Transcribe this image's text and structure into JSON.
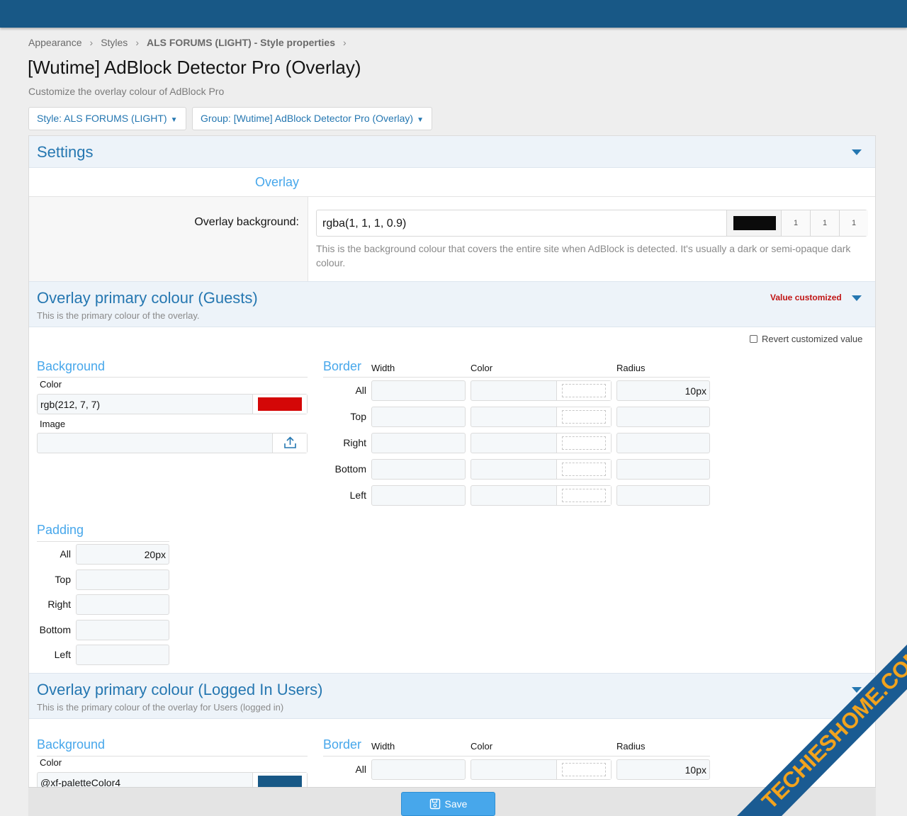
{
  "breadcrumb": {
    "items": [
      "Appearance",
      "Styles",
      "ALS FORUMS (LIGHT) - Style properties"
    ]
  },
  "page": {
    "title": "[Wutime] AdBlock Detector Pro (Overlay)",
    "description": "Customize the overlay colour of AdBlock Pro"
  },
  "filters": {
    "style": "Style: ALS FORUMS (LIGHT)",
    "group": "Group: [Wutime] AdBlock Detector Pro (Overlay)"
  },
  "settings": {
    "title": "Settings",
    "section": "Overlay",
    "overlay_bg": {
      "label": "Overlay background:",
      "value": "rgba(1, 1, 1, 0.9)",
      "swatch": "#0b0b0b",
      "channels": [
        "1",
        "1",
        "1"
      ],
      "explain": "This is the background colour that covers the entire site when AdBlock is detected. It's usually a dark or semi-opaque dark colour."
    }
  },
  "guests": {
    "title": "Overlay primary colour (Guests)",
    "description": "This is the primary colour of the overlay.",
    "status": "Value customized",
    "revert": "Revert customized value",
    "background": {
      "title": "Background",
      "color_label": "Color",
      "color_value": "rgb(212, 7, 7)",
      "swatch": "#d40707",
      "image_label": "Image",
      "image_value": ""
    },
    "border": {
      "title": "Border",
      "cols": [
        "Width",
        "Color",
        "Radius"
      ],
      "rows": [
        "All",
        "Top",
        "Right",
        "Bottom",
        "Left"
      ],
      "radius_all": "10px"
    },
    "padding": {
      "title": "Padding",
      "rows": [
        "All",
        "Top",
        "Right",
        "Bottom",
        "Left"
      ],
      "all": "20px"
    }
  },
  "users": {
    "title": "Overlay primary colour (Logged In Users)",
    "description": "This is the primary colour of the overlay for Users (logged in)",
    "background": {
      "title": "Background",
      "color_label": "Color",
      "color_value": "@xf-paletteColor4",
      "swatch": "#185886"
    },
    "border": {
      "title": "Border",
      "cols": [
        "Width",
        "Color",
        "Radius"
      ],
      "all_label": "All",
      "radius_all": "10px"
    }
  },
  "save": "Save",
  "watermark": "TECHIESHOME.COM",
  "colors": {
    "accent": "#2577b1",
    "topbar": "#185886",
    "link": "#47a7eb",
    "customized": "#c01414"
  }
}
